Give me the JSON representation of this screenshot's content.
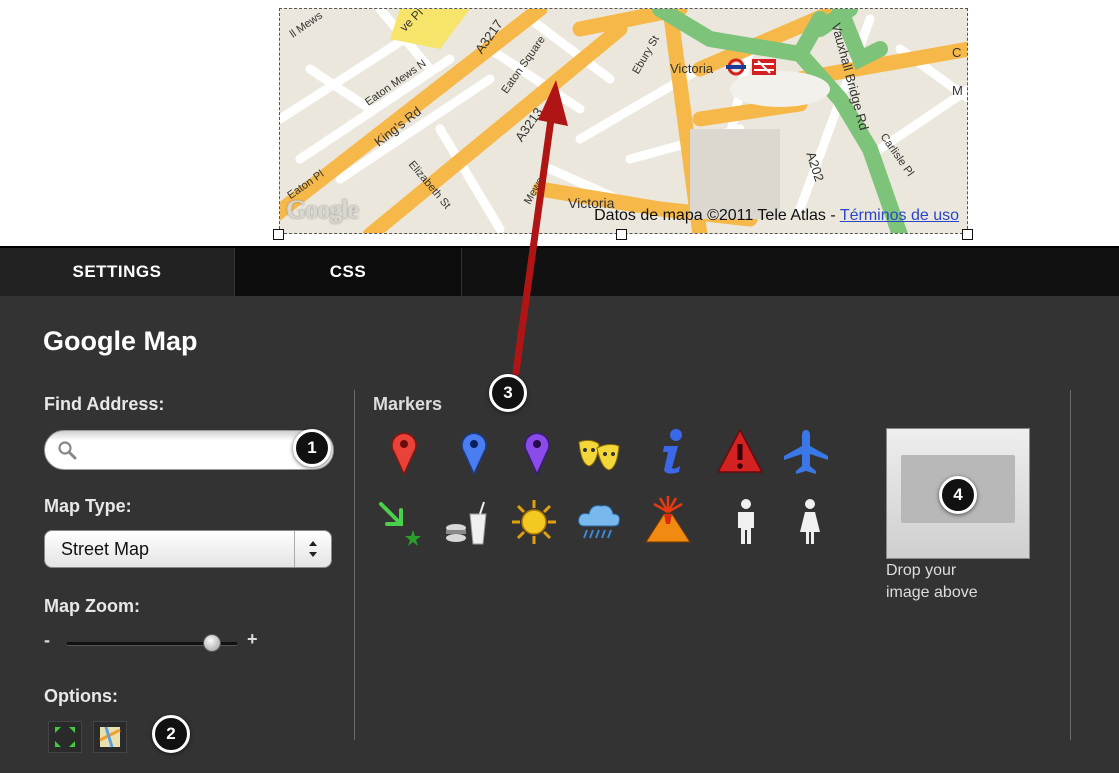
{
  "map": {
    "labels": {
      "mews_1": "ll Mews",
      "eaton_mews_n": "Eaton Mews N",
      "eaton_pl": "Eaton Pl",
      "kings_rd": "King's Rd",
      "a3217": "A3217",
      "eaton_square": "Eaton Square",
      "a3213": "A3213",
      "ebury_st": "Ebury St",
      "victoria_station": "Victoria",
      "vauxhall_bridge_rd": "Vauxhall Bridge Rd",
      "a202": "A202",
      "carlisle_pl": "Carlisle Pl",
      "elizabeth_st": "Elizabeth St",
      "victoria_bottom": "Victoria",
      "mews_2": "Mews",
      "eve_pl": "ve Pl",
      "right_c": "C",
      "right_m": "M"
    },
    "google_logo": "Google",
    "attribution_text": "Datos de mapa ©2011 Tele Atlas - ",
    "terms_link": "Términos de uso"
  },
  "panel": {
    "tabs": [
      "SETTINGS",
      "CSS"
    ],
    "title": "Google Map",
    "find_address_label": "Find Address:",
    "search_value": "",
    "map_type_label": "Map Type:",
    "map_type_value": "Street Map",
    "map_zoom_label": "Map Zoom:",
    "zoom_minus": "-",
    "zoom_plus": "+",
    "zoom_level_fraction": 0.85,
    "options_label": "Options:",
    "markers_label": "Markers",
    "markers": [
      "red-pin-icon",
      "blue-pin-icon",
      "purple-pin-icon",
      "theater-masks-icon",
      "info-icon",
      "warning-icon",
      "airplane-icon",
      "arrow-down-right-icon",
      "fast-food-icon",
      "sun-icon",
      "rain-cloud-icon",
      "volcano-icon",
      "man-icon",
      "woman-icon"
    ],
    "drop_text_line1": "Drop your",
    "drop_text_line2": "image above"
  },
  "badges": [
    "1",
    "2",
    "3",
    "4"
  ],
  "colors": {
    "panel_bg": "#333333",
    "tabbar_bg": "#111111",
    "arrow": "#b01515",
    "road_orange": "#f6b848",
    "road_green": "#7dc47a"
  }
}
